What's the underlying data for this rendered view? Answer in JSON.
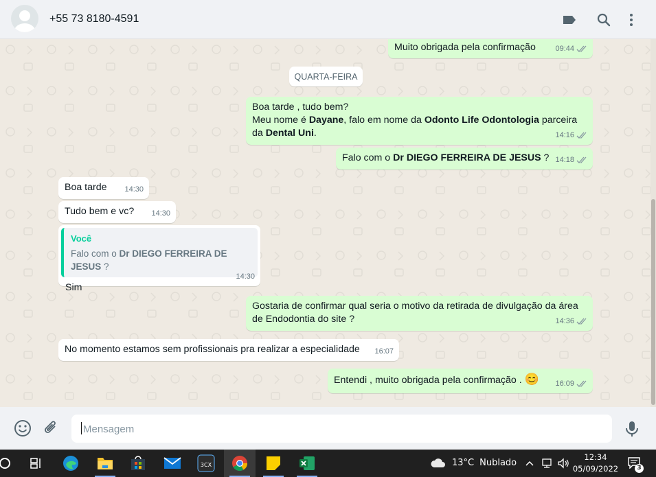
{
  "header": {
    "contact_name": "+55 73 8180-4591",
    "icons": [
      "avatar",
      "label-icon",
      "search-icon",
      "menu-dots-icon"
    ]
  },
  "chat": {
    "day_divider": "QUARTA-FEIRA",
    "messages": [
      {
        "dir": "out",
        "text": "Muito obrigada pela confirmação",
        "time": "09:44"
      },
      {
        "dir": "out",
        "line1": "Boa tarde , tudo bem?",
        "line2_a": "Meu nome é ",
        "line2_b": "Dayane",
        "line2_c": ", falo em nome da ",
        "line2_d": "Odonto Life Odontologia",
        "line2_e": " parceira",
        "line3_a": "da ",
        "line3_b": "Dental Uni",
        "line3_c": ".",
        "time": "14:16"
      },
      {
        "dir": "out",
        "text_a": "Falo com o ",
        "text_b": "Dr DIEGO FERREIRA DE JESUS",
        "text_c": "  ?",
        "time": "14:18"
      },
      {
        "dir": "in",
        "text": "Boa tarde",
        "time": "14:30"
      },
      {
        "dir": "in",
        "text": "Tudo bem e vc?",
        "time": "14:30"
      },
      {
        "dir": "in",
        "quote_author": "Você",
        "quote_a": "Falo com o ",
        "quote_b": "Dr DIEGO FERREIRA DE JESUS",
        "quote_c": "  ?",
        "text": "Sim",
        "time": "14:30"
      },
      {
        "dir": "out",
        "line1": "Gostaria de confirmar qual seria o motivo da retirada de divulgação da área",
        "line2": "de Endodontia do site ?",
        "time": "14:36"
      },
      {
        "dir": "in",
        "text": "No momento estamos sem profissionais pra realizar a especialidade",
        "time": "16:07"
      },
      {
        "dir": "out",
        "text": "Entendi , muito obrigada pela confirmação .",
        "emoji": "😊",
        "time": "16:09"
      }
    ]
  },
  "footer": {
    "placeholder": "Mensagem",
    "icons": [
      "emoji-icon",
      "attach-icon",
      "mic-icon"
    ]
  },
  "taskbar": {
    "apps": [
      "cortana-circle-icon",
      "task-view-icon",
      "edge-icon",
      "file-explorer-icon",
      "store-icon",
      "mail-icon",
      "3cx-icon",
      "chrome-icon",
      "sticky-notes-icon",
      "excel-icon"
    ],
    "app_3cx_label": "3CX",
    "weather_temp": "13°C",
    "weather_desc": "Nublado",
    "time": "12:34",
    "date": "05/09/2022",
    "notification_count": "3"
  },
  "colors": {
    "outgoing_bubble": "#d9fdd3",
    "incoming_bubble": "#ffffff",
    "chat_bg": "#efeae2",
    "quote_accent": "#06cf9c"
  }
}
